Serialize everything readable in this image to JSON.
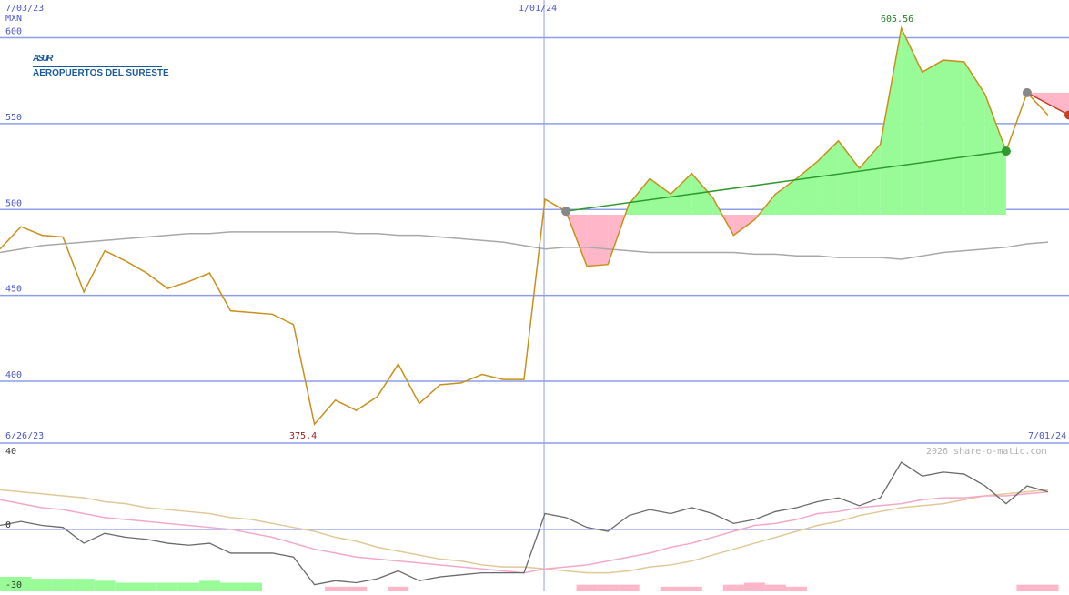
{
  "header": {
    "start_date": "7/03/23",
    "mid_date": "1/01/24",
    "currency": "MXN",
    "high_label": "605.56",
    "low_label": "375.4",
    "period_start": "6/26/23",
    "period_end": "7/01/24",
    "watermark": "2026 share-o-matic.com"
  },
  "logo": {
    "name": "ASUR",
    "tagline": "AEROPUERTOS DEL SURESTE"
  },
  "colors": {
    "price": "#c8901a",
    "gridline": "#8c9ee8",
    "axis_text": "#4a56c8",
    "moving_average": "#a8a8a8",
    "gain_fill": "#98fb98",
    "loss_fill": "#ffb6c8",
    "trend_up": "#2e9a2e",
    "trend_down": "#c04020",
    "oscillator": "#6a6a6a",
    "signal_pink": "#f4a8c8",
    "signal_tan": "#e0c898",
    "logo_blue": "#1a5a9a"
  },
  "chart_data": [
    {
      "type": "line",
      "title": "",
      "ylabel": "MXN",
      "ylim": [
        364,
        622
      ],
      "yticks": [
        400,
        450,
        500,
        550,
        600
      ],
      "ytick_labels": [
        "400",
        "450",
        "500",
        "550",
        "600"
      ],
      "x_range": [
        0,
        51
      ],
      "x_labels": [
        {
          "index": 26,
          "label": "1/01/24"
        }
      ],
      "series": [
        {
          "values": [
            477,
            490,
            485,
            484,
            452,
            476,
            470,
            463,
            454,
            458,
            463,
            441,
            440,
            439,
            433,
            375,
            389,
            383,
            391,
            410,
            387,
            398,
            399,
            404,
            401,
            401,
            506,
            499,
            467,
            468,
            503,
            518,
            509,
            521,
            507,
            485,
            494,
            509,
            518,
            528,
            540,
            524,
            538,
            605.56,
            580,
            587,
            586,
            567,
            534,
            568,
            555
          ]
        },
        {
          "values": [
            475,
            477,
            479,
            480,
            481,
            482,
            483,
            484,
            485,
            486,
            486,
            487,
            487,
            487,
            487,
            487,
            487,
            486,
            486,
            485,
            485,
            484,
            483,
            482,
            481,
            479,
            477,
            478,
            478,
            477,
            476,
            475,
            475,
            475,
            475,
            475,
            474,
            474,
            473,
            473,
            472,
            472,
            472,
            471,
            473,
            475,
            476,
            477,
            478,
            480,
            481
          ]
        },
        {
          "type": "trend",
          "from_index": 27,
          "to_index": 48,
          "from_value": 499,
          "to_value": 534,
          "direction": "up"
        },
        {
          "type": "trend",
          "from_index": 49,
          "to_index": 51,
          "from_value": 568,
          "to_value": 555,
          "direction": "down"
        }
      ],
      "annotations": {
        "high": {
          "index": 43,
          "value": 605.56,
          "label": "605.56"
        },
        "low": {
          "index": 15,
          "value": 375.4,
          "label": "375.4"
        }
      },
      "band_baseline": 497,
      "band_range": [
        27,
        48
      ]
    },
    {
      "type": "line",
      "title": "",
      "ylim": [
        -30,
        40
      ],
      "yticks": [
        40,
        0,
        -30
      ],
      "ytick_labels": [
        "40",
        "0",
        "-30"
      ],
      "x_range": [
        0,
        51
      ],
      "series": [
        {
          "values": [
            2,
            4,
            2,
            1,
            -7,
            -2,
            -4,
            -5,
            -7,
            -8,
            -7,
            -12,
            -12,
            -12,
            -14,
            -28,
            -26,
            -27,
            -25,
            -21,
            -26,
            -24,
            -23,
            -22,
            -22,
            -22,
            8,
            6,
            1,
            -1,
            7,
            10,
            8,
            11,
            8,
            3,
            5,
            9,
            11,
            14,
            16,
            12,
            16,
            34,
            27,
            29,
            28,
            22,
            13,
            22,
            19
          ]
        },
        {
          "values": [
            15,
            13,
            11,
            10,
            8,
            6,
            5,
            4,
            3,
            2,
            1,
            0,
            -2,
            -4,
            -7,
            -10,
            -12,
            -14,
            -15,
            -16,
            -17,
            -18,
            -19,
            -20,
            -21,
            -22,
            -20,
            -19,
            -18,
            -16,
            -14,
            -12,
            -9,
            -7,
            -4,
            -1,
            2,
            3,
            5,
            8,
            9,
            11,
            12,
            13,
            15,
            16,
            16,
            17,
            17,
            18,
            19
          ]
        },
        {
          "values": [
            20,
            19,
            18,
            17,
            16,
            14,
            13,
            11,
            10,
            9,
            8,
            6,
            5,
            3,
            1,
            -1,
            -4,
            -6,
            -9,
            -11,
            -13,
            -15,
            -16,
            -18,
            -19,
            -19,
            -20,
            -21,
            -22,
            -22,
            -21,
            -19,
            -18,
            -16,
            -13,
            -10,
            -7,
            -4,
            -1,
            2,
            4,
            7,
            9,
            11,
            12,
            13,
            15,
            17,
            18,
            19,
            20
          ]
        },
        {
          "type": "histogram",
          "values": [
            -24,
            -24,
            -25,
            -25,
            -25,
            -26,
            -27,
            -27,
            -27,
            -27,
            -26,
            -27,
            -27,
            0,
            0,
            0,
            -29,
            -29,
            0,
            -29,
            0,
            0,
            0,
            0,
            0,
            0,
            0,
            0,
            -28,
            -28,
            -28,
            0,
            -29,
            -29,
            0,
            -28,
            -27,
            -28,
            -29,
            0,
            0,
            0,
            0,
            0,
            0,
            0,
            0,
            0,
            0,
            -28,
            -28
          ],
          "colors_by_sign": [
            "gain",
            "gain",
            "gain",
            "gain",
            "gain",
            "gain",
            "gain",
            "gain",
            "gain",
            "gain",
            "gain",
            "gain",
            "gain",
            "none",
            "none",
            "none",
            "loss",
            "loss",
            "none",
            "loss",
            "none",
            "none",
            "none",
            "none",
            "none",
            "none",
            "none",
            "none",
            "loss",
            "loss",
            "loss",
            "none",
            "loss",
            "loss",
            "none",
            "loss",
            "loss",
            "loss",
            "loss",
            "none",
            "none",
            "none",
            "none",
            "none",
            "none",
            "none",
            "none",
            "none",
            "none",
            "loss",
            "loss"
          ]
        }
      ]
    }
  ]
}
